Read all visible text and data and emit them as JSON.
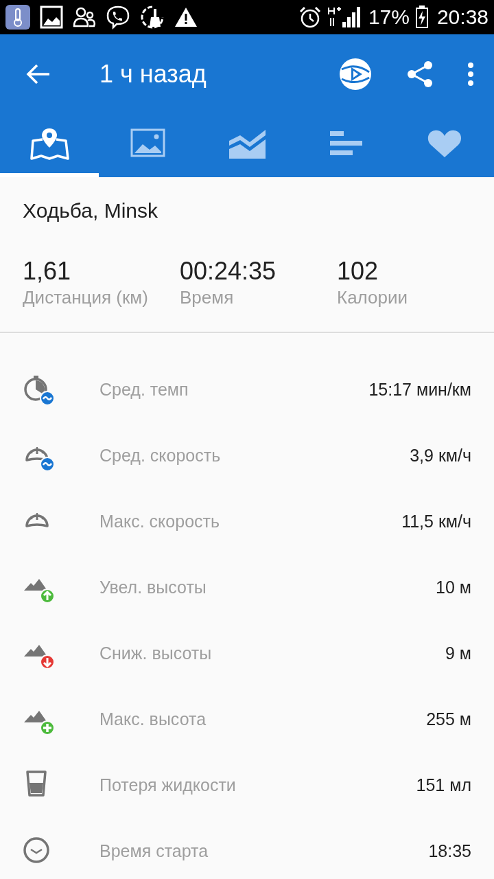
{
  "status_bar": {
    "battery": "17%",
    "time": "20:38"
  },
  "toolbar": {
    "title": "1 ч назад"
  },
  "tabs": [
    {
      "kind": "map",
      "selected": true
    },
    {
      "kind": "photo",
      "selected": false
    },
    {
      "kind": "chart",
      "selected": false
    },
    {
      "kind": "bars",
      "selected": false
    },
    {
      "kind": "heart",
      "selected": false
    }
  ],
  "activity": "Ходьба, Minsk",
  "summary": [
    {
      "value": "1,61",
      "label": "Дистанция (км)"
    },
    {
      "value": "00:24:35",
      "label": "Время"
    },
    {
      "value": "102",
      "label": "Калории"
    }
  ],
  "stats": [
    {
      "kind": "pace",
      "label": "Сред. темп",
      "value": "15:17 мин/км"
    },
    {
      "kind": "avg_speed",
      "label": "Сред. скорость",
      "value": "3,9 км/ч"
    },
    {
      "kind": "max_speed",
      "label": "Макс. скорость",
      "value": "11,5 км/ч"
    },
    {
      "kind": "ascent",
      "label": "Увел. высоты",
      "value": "10 м"
    },
    {
      "kind": "descent",
      "label": "Сниж. высоты",
      "value": "9 м"
    },
    {
      "kind": "max_alt",
      "label": "Макс. высота",
      "value": "255 м"
    },
    {
      "kind": "fluid",
      "label": "Потеря жидкости",
      "value": "151 мл"
    },
    {
      "kind": "start",
      "label": "Время старта",
      "value": "18:35"
    }
  ]
}
